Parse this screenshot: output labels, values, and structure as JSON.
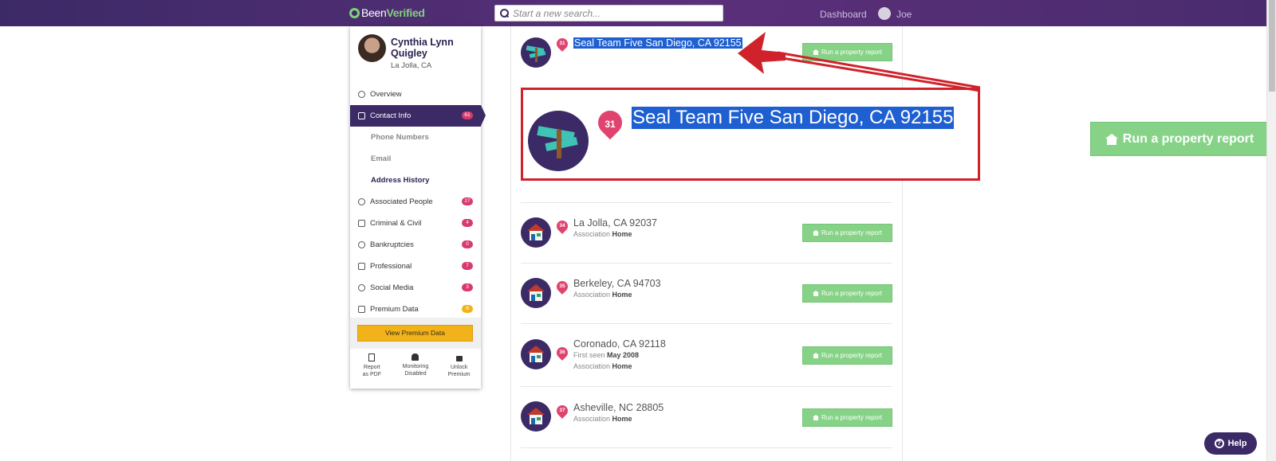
{
  "nav": {
    "logo_prefix": "Been",
    "logo_suffix": "Verified",
    "search_placeholder": "Start a new search...",
    "dashboard_label": "Dashboard",
    "user_name": "Joe"
  },
  "profile": {
    "name": "Cynthia Lynn Quigley",
    "location": "La Jolla, CA"
  },
  "sidebar": {
    "items": [
      {
        "label": "Overview"
      },
      {
        "label": "Contact Info",
        "badge": "61"
      },
      {
        "label": "Phone Numbers"
      },
      {
        "label": "Email"
      },
      {
        "label": "Address History"
      },
      {
        "label": "Associated People",
        "badge": "27"
      },
      {
        "label": "Criminal & Civil",
        "badge": "4"
      },
      {
        "label": "Bankruptcies",
        "badge": "0"
      },
      {
        "label": "Professional",
        "badge": "7"
      },
      {
        "label": "Social Media",
        "badge": "3"
      },
      {
        "label": "Premium Data",
        "badge": "8"
      }
    ],
    "premium_button": "View Premium Data",
    "tools": [
      {
        "line1": "Report",
        "line2": "as PDF"
      },
      {
        "line1": "Monitoring",
        "line2": "Disabled"
      },
      {
        "line1": "Unlock",
        "line2": "Premium"
      }
    ]
  },
  "addresses": [
    {
      "pin": "31",
      "title": "Seal Team Five San Diego, CA 92155",
      "sub_prefix": "",
      "sub_value": "",
      "first_seen_prefix": "",
      "first_seen": "",
      "button": "Run a property report"
    },
    {
      "pin": "34",
      "title": "La Jolla, CA 92037",
      "sub_prefix": "Association",
      "sub_value": "Home",
      "button": "Run a property report"
    },
    {
      "pin": "35",
      "title": "Berkeley, CA 94703",
      "sub_prefix": "Association",
      "sub_value": "Home",
      "button": "Run a property report"
    },
    {
      "pin": "36",
      "title": "Coronado, CA 92118",
      "first_seen_prefix": "First seen",
      "first_seen": "May 2008",
      "sub_prefix": "Association",
      "sub_value": "Home",
      "button": "Run a property report"
    },
    {
      "pin": "37",
      "title": "Asheville, NC 28805",
      "sub_prefix": "Association",
      "sub_value": "Home",
      "button": "Run a property report"
    }
  ],
  "zoom": {
    "pin": "31",
    "title": "Seal Team Five San Diego, CA 92155",
    "button": "Run a property report"
  },
  "help_label": "Help",
  "colors": {
    "nav_purple": "#3c2a66",
    "accent_green": "#86d387",
    "badge_pink": "#d83a6e",
    "premium_yellow": "#f2b31a",
    "annotation_red": "#d0222b",
    "selection_blue": "#1e5fd1"
  }
}
